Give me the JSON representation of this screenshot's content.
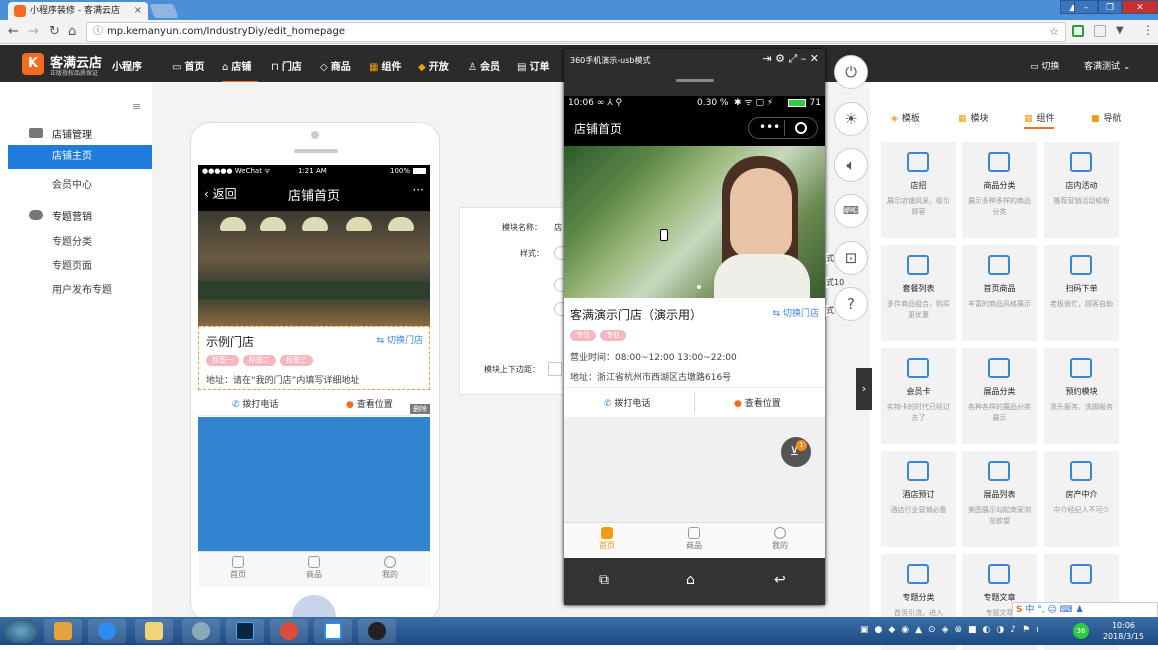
{
  "browser": {
    "tab_title": "小程序装修 - 客满云店",
    "url": "mp.kemanyun.com/IndustryDiy/edit_homepage"
  },
  "header": {
    "brand": "客满云店",
    "brand_sub": "正版授权品质保证",
    "mini": "小程序",
    "menu": [
      "首页",
      "店铺",
      "门店",
      "商品",
      "组件",
      "开放",
      "会员",
      "订单"
    ],
    "switch": "切换",
    "account": "客满测试"
  },
  "sidebar": {
    "group1": "店铺管理",
    "group1_items": [
      "店铺主页",
      "会员中心"
    ],
    "group2": "专题营销",
    "group2_items": [
      "专题分类",
      "专题页面",
      "用户发布专题"
    ]
  },
  "preview": {
    "status_left": "●●●●● WeChat ᯤ",
    "status_time": "1:21 AM",
    "status_right": "100%",
    "back": "返回",
    "title": "店铺首页",
    "more": "···",
    "store_name": "示例门店",
    "switch_store": "切换门店",
    "tags": [
      "标签一",
      "标签二",
      "标签三"
    ],
    "address": "地址：请在“我的门店”内填写详细地址",
    "call": "拨打电话",
    "location": "查看位置",
    "delete": "删除",
    "tabs": [
      "首页",
      "商品",
      "我的"
    ]
  },
  "form": {
    "name_label": "模块名称：",
    "name_value": "店",
    "style_label": "样式：",
    "margin_label": "模块上下边距："
  },
  "emulator": {
    "title": "360手机演示-usb模式",
    "status_time": "10:06",
    "status_right": "0.30 %",
    "battery": "71",
    "nav_title": "店铺首页",
    "store_name": "客满演示门店（演示用）",
    "switch_store": "切换门店",
    "tags": [
      "专注",
      "专业"
    ],
    "hours": "营业时间：08:00~12:00 13:00~22:00",
    "address": "地址：浙江省杭州市西湖区古墩路616号",
    "call": "拨打电话",
    "location": "查看位置",
    "cart_badge": "1",
    "tabs": [
      "首页",
      "商品",
      "我的"
    ],
    "peek1": "式10",
    "peek2": "式"
  },
  "components": {
    "tabs": [
      "模板",
      "模块",
      "组件",
      "导航"
    ],
    "cards": [
      {
        "title": "店招",
        "desc": "展示店铺风采，吸引顾客"
      },
      {
        "title": "商品分类",
        "desc": "展示多种多样的商品分类"
      },
      {
        "title": "店内活动",
        "desc": "推荐营销活动吸粉"
      },
      {
        "title": "套餐列表",
        "desc": "多件商品组合，购买更优惠"
      },
      {
        "title": "首页商品",
        "desc": "丰富的商品风格展示"
      },
      {
        "title": "扫码下单",
        "desc": "老板很忙，顾客自助"
      },
      {
        "title": "会员卡",
        "desc": "实物卡的时代已经过去了"
      },
      {
        "title": "展品分类",
        "desc": "各种各样的展品分类展示"
      },
      {
        "title": "预约模块",
        "desc": "洗头服务，洗脚服务"
      },
      {
        "title": "酒店预订",
        "desc": "酒店行业营销必备"
      },
      {
        "title": "展品列表",
        "desc": "美图展示勾起商家浏览欲望"
      },
      {
        "title": "房产中介",
        "desc": "中介经纪人不可少"
      },
      {
        "title": "专题分类",
        "desc": "首页引流，进入"
      },
      {
        "title": "专题文章",
        "desc": "专题文章"
      },
      {
        "title": "",
        "desc": ""
      }
    ]
  },
  "taskbar": {
    "time": "10:06",
    "date": "2018/3/15",
    "ime": "中 °, ☺ ⌨ ♟"
  }
}
